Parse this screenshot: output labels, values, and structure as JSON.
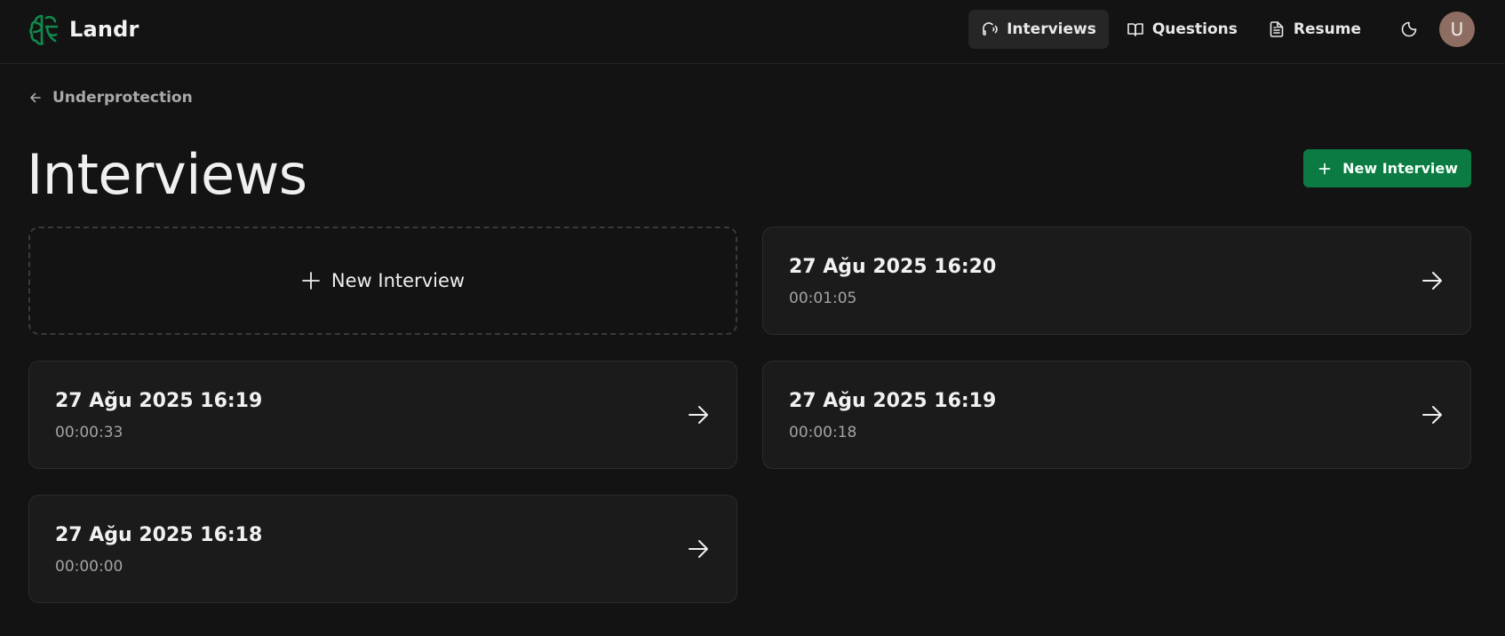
{
  "app": {
    "name": "Landr"
  },
  "nav": {
    "items": [
      {
        "label": "Interviews",
        "icon": "headset-icon",
        "active": true
      },
      {
        "label": "Questions",
        "icon": "book-icon",
        "active": false
      },
      {
        "label": "Resume",
        "icon": "document-icon",
        "active": false
      }
    ],
    "theme_icon": "moon-icon",
    "avatar_initial": "U"
  },
  "breadcrumb": {
    "back_label": "Underprotection"
  },
  "page": {
    "title": "Interviews",
    "new_button": "New Interview"
  },
  "new_card": {
    "label": "New Interview"
  },
  "interviews": [
    {
      "date": "27 Ağu 2025 16:20",
      "duration": "00:01:05"
    },
    {
      "date": "27 Ağu 2025 16:19",
      "duration": "00:00:33"
    },
    {
      "date": "27 Ağu 2025 16:19",
      "duration": "00:00:18"
    },
    {
      "date": "27 Ağu 2025 16:18",
      "duration": "00:00:00"
    }
  ],
  "colors": {
    "accent": "#0b7a43",
    "background": "#131313",
    "card": "#1b1b1b",
    "avatar": "#8e6e63"
  }
}
